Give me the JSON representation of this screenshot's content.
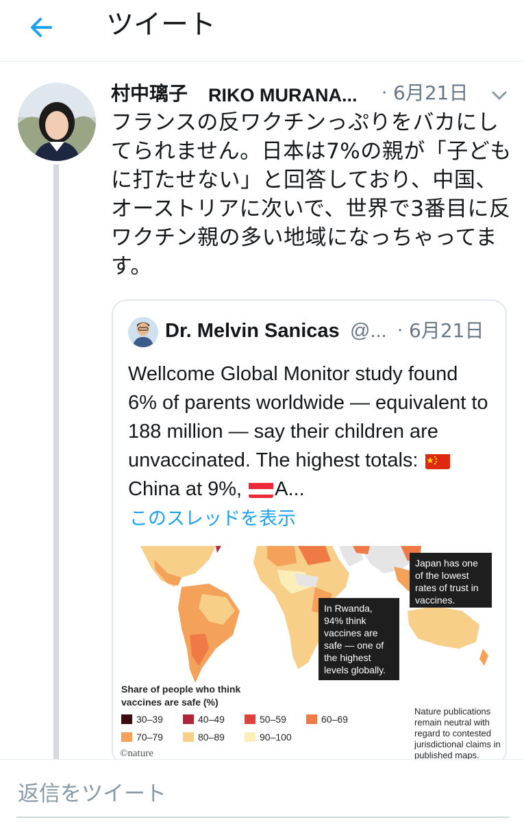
{
  "header": {
    "title": "ツイート"
  },
  "tweet": {
    "display_name": "村中璃子",
    "handle": "RIKO MURANA...",
    "separator": "·",
    "date": "6月21日",
    "text": "フランスの反ワクチンっぷりをバカにしてられません。日本は7%の親が「子どもに打たせない」と回答しており、中国、オーストリアに次いで、世界で3番目に反ワクチン親の多い地域になっちゃってます。"
  },
  "quote": {
    "display_name": "Dr. Melvin Sanicas",
    "handle": "@...",
    "separator": "·",
    "date": "6月21日",
    "text_before_flag1": "Wellcome Global Monitor study found 6% of parents worldwide — equivalent to 188 million — say their children are unvaccinated. The highest totals: ",
    "text_after_flag1": "China at 9%, ",
    "text_after_flag2": "A...",
    "show_thread": "このスレッドを表示",
    "media": {
      "callout_japan": "Japan has one of the lowest rates of trust in vaccines.",
      "callout_rwanda": "In Rwanda, 94% think vaccines are safe — one of the highest levels globally.",
      "legend_title": "Share of people who think vaccines are safe (%)",
      "legend": [
        {
          "label": "30–39",
          "color": "#3d0a12"
        },
        {
          "label": "40–49",
          "color": "#b0243c"
        },
        {
          "label": "50–59",
          "color": "#e0413a"
        },
        {
          "label": "60–69",
          "color": "#f07a45"
        },
        {
          "label": "70–79",
          "color": "#f4a25a"
        },
        {
          "label": "80–89",
          "color": "#f8cf88"
        },
        {
          "label": "90–100",
          "color": "#fbeeb8"
        }
      ],
      "note": "Nature publications remain neutral with regard to contested jurisdictional claims in published maps.",
      "credit": "©nature"
    }
  },
  "reply": {
    "placeholder": "返信をツイート"
  },
  "colors": {
    "accent": "#1da1f2",
    "secondary_text": "#657786",
    "border": "#e1e8ed"
  }
}
